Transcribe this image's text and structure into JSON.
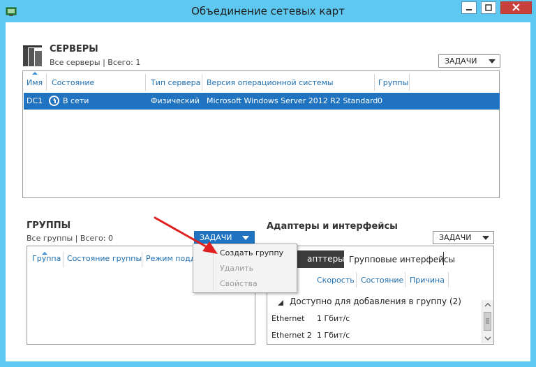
{
  "window": {
    "title": "Объединение сетевых карт",
    "min_glyph": "▁",
    "max_glyph": "□",
    "close_glyph": "✕",
    "accent_color": "#5ec8f0",
    "selection_color": "#1f73c0"
  },
  "servers": {
    "heading": "СЕРВЕРЫ",
    "summary": "Все серверы | Всего: 1",
    "tasks_label": "ЗАДАЧИ",
    "columns": [
      "Имя",
      "Состояние",
      "Тип сервера",
      "Версия операционной системы",
      "Группы"
    ],
    "rows": [
      {
        "name": "DC1",
        "status": "В сети",
        "type": "Физический",
        "os": "Microsoft Windows Server 2012 R2 Standard",
        "groups": "0"
      }
    ]
  },
  "groups": {
    "heading": "ГРУППЫ",
    "summary": "Все группы | Всего: 0",
    "tasks_label": "ЗАДАЧИ",
    "columns": [
      "Группа",
      "Состояние группы",
      "Режим подд"
    ]
  },
  "tasks_menu": {
    "items": [
      {
        "label": "Создать группу",
        "enabled": true
      },
      {
        "label": "Удалить",
        "enabled": false
      },
      {
        "label": "Свойства",
        "enabled": false
      }
    ]
  },
  "adapters": {
    "heading": "Адаптеры и интерфейсы",
    "tasks_label": "ЗАДАЧИ",
    "tabs": [
      "апттеры",
      "Групповые интерфейсы"
    ],
    "columns": [
      "Скорость",
      "Состояние",
      "Причина"
    ],
    "group_header": "Доступно для добавления в группу (2)",
    "rows": [
      {
        "name": "Ethernet",
        "speed": "1 Гбит/с"
      },
      {
        "name": "Ethernet 2",
        "speed": "1 Гбит/с"
      }
    ]
  },
  "icons": {
    "app": "network-teaming-icon",
    "servers": "servers-icon",
    "status_online": "online-status-icon",
    "collapse": "collapse-triangle-icon",
    "pointer": "red-arrow-annotation"
  }
}
